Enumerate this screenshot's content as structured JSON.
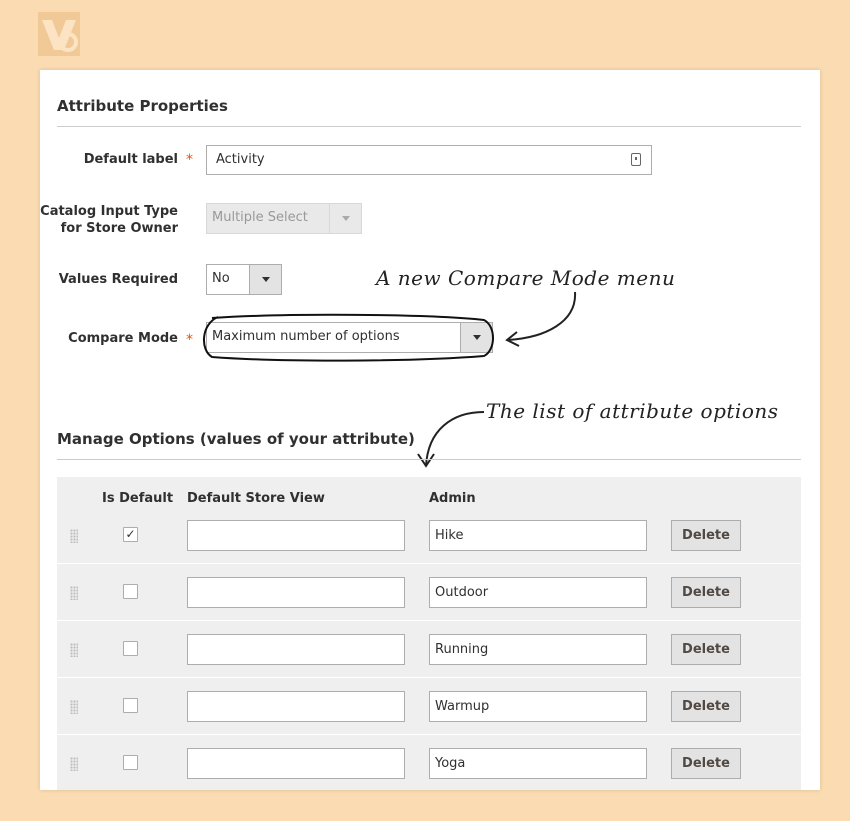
{
  "colors": {
    "page_bg": "#fbdcb2",
    "panel_bg": "#ffffff",
    "required": "#eb5202",
    "grid_bg": "#efefef"
  },
  "logo": {
    "icon": "brand-logo-icon"
  },
  "attribute_properties": {
    "title": "Attribute Properties",
    "default_label": {
      "label": "Default label",
      "value": "Activity",
      "required": true
    },
    "catalog_input_type": {
      "label_line1": "Catalog Input Type",
      "label_line2": "for Store Owner",
      "value": "Multiple Select",
      "disabled": true
    },
    "values_required": {
      "label": "Values Required",
      "value": "No"
    },
    "compare_mode": {
      "label": "Compare Mode",
      "value": "Maximum number of options",
      "required": true
    }
  },
  "annotations": {
    "compare_mode_note": "A new Compare Mode menu",
    "options_note": "The list of attribute options"
  },
  "manage_options": {
    "title": "Manage Options (values of your attribute)",
    "columns": {
      "is_default": "Is Default",
      "store_view": "Default Store View",
      "admin": "Admin"
    },
    "delete_label": "Delete",
    "rows": [
      {
        "is_default": true,
        "store_view": "",
        "admin": "Hike"
      },
      {
        "is_default": false,
        "store_view": "",
        "admin": "Outdoor"
      },
      {
        "is_default": false,
        "store_view": "",
        "admin": "Running"
      },
      {
        "is_default": false,
        "store_view": "",
        "admin": "Warmup"
      },
      {
        "is_default": false,
        "store_view": "",
        "admin": "Yoga"
      }
    ]
  }
}
